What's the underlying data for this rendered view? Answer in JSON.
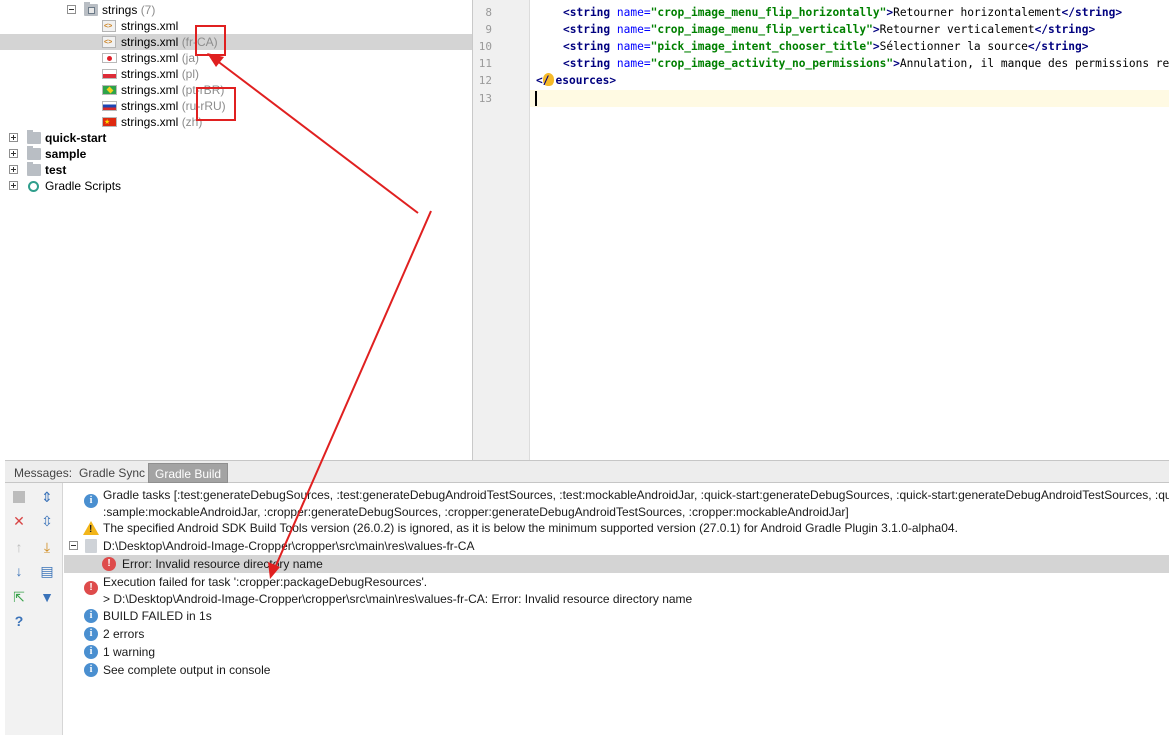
{
  "tree": {
    "strings_folder": {
      "label": "strings",
      "count": "(7)"
    },
    "files": [
      {
        "name": "strings.xml",
        "qualifier": "",
        "icon": "xml-icon"
      },
      {
        "name": "strings.xml",
        "qualifier": "(fr-CA)",
        "icon": "xml-icon"
      },
      {
        "name": "strings.xml",
        "qualifier": "(ja)",
        "icon": "flag-jp-icon"
      },
      {
        "name": "strings.xml",
        "qualifier": "(pl)",
        "icon": "flag-pl-icon"
      },
      {
        "name": "strings.xml",
        "qualifier": "(pt-rBR)",
        "icon": "flag-br-icon"
      },
      {
        "name": "strings.xml",
        "qualifier": "(ru-rRU)",
        "icon": "flag-ru-icon"
      },
      {
        "name": "strings.xml",
        "qualifier": "(zh)",
        "icon": "flag-cn-icon"
      }
    ],
    "modules": [
      {
        "label": "quick-start"
      },
      {
        "label": "sample"
      },
      {
        "label": "test"
      },
      {
        "label": "Gradle Scripts"
      }
    ]
  },
  "editor": {
    "lines": [
      {
        "num": "8",
        "name": "crop_image_menu_flip_horizontally",
        "text": "Retourner horizontalement"
      },
      {
        "num": "9",
        "name": "crop_image_menu_flip_vertically",
        "text": "Retourner verticalement"
      },
      {
        "num": "10",
        "name": "pick_image_intent_chooser_title",
        "text": "Sélectionner la source"
      },
      {
        "num": "11",
        "name": "crop_image_activity_no_permissions",
        "text": "Annulation, il manque des permissions requises"
      }
    ],
    "string_open": "<string",
    "name_attr": " name=",
    "string_close": "</string>",
    "line12": {
      "num": "12",
      "close_tag_a": "</",
      "close_tag_b": "esources>"
    },
    "line13": {
      "num": "13"
    }
  },
  "toolwindow": {
    "tabs": {
      "messages": "Messages:",
      "gradle_sync": "Gradle Sync",
      "gradle_build": "Gradle Build"
    },
    "messages": [
      {
        "type": "info",
        "text": "Gradle tasks [:test:generateDebugSources, :test:generateDebugAndroidTestSources, :test:mockableAndroidJar, :quick-start:generateDebugSources, :quick-start:generateDebugAndroidTestSources, :quick-start:mockableAndroidJar,",
        "text2": ":sample:mockableAndroidJar, :cropper:generateDebugSources, :cropper:generateDebugAndroidTestSources, :cropper:mockableAndroidJar]"
      },
      {
        "type": "warning",
        "text": "The specified Android SDK Build Tools version (26.0.2) is ignored, as it is below the minimum supported version (27.0.1) for Android Gradle Plugin 3.1.0-alpha04."
      },
      {
        "type": "file",
        "text": "D:\\Desktop\\Android-Image-Cropper\\cropper\\src\\main\\res\\values-fr-CA"
      },
      {
        "type": "error",
        "text": "Error: Invalid resource directory name"
      },
      {
        "type": "error",
        "text": "Execution failed for task ':cropper:packageDebugResources'.",
        "text2": "> D:\\Desktop\\Android-Image-Cropper\\cropper\\src\\main\\res\\values-fr-CA: Error: Invalid resource directory name"
      },
      {
        "type": "info",
        "text": "BUILD FAILED in 1s"
      },
      {
        "type": "info",
        "text": "2 errors"
      },
      {
        "type": "info",
        "text": "1 warning"
      },
      {
        "type": "info",
        "text": "See complete output in console"
      }
    ],
    "info_glyph": "i",
    "error_glyph": "!",
    "warning_glyph": "!"
  },
  "colors": {
    "annotation_red": "#e02020",
    "selection": "#d4d4d4"
  }
}
